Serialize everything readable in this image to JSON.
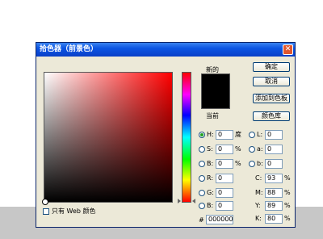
{
  "window": {
    "title": "拾色器（前景色）",
    "close": "✕"
  },
  "preview": {
    "new_label": "新的",
    "current_label": "当前"
  },
  "buttons": {
    "ok": "确定",
    "cancel": "取消",
    "add_swatch": "添加到色板",
    "color_library": "颜色库"
  },
  "hsb": {
    "h": {
      "label": "H:",
      "value": "0",
      "unit": "度",
      "selected": true
    },
    "s": {
      "label": "S:",
      "value": "0",
      "unit": "%"
    },
    "b": {
      "label": "B:",
      "value": "0",
      "unit": "%"
    }
  },
  "lab": {
    "l": {
      "label": "L:",
      "value": "0"
    },
    "a": {
      "label": "a:",
      "value": "0"
    },
    "b": {
      "label": "b:",
      "value": "0"
    }
  },
  "rgb": {
    "r": {
      "label": "R:",
      "value": "0"
    },
    "g": {
      "label": "G:",
      "value": "0"
    },
    "b": {
      "label": "B:",
      "value": "0"
    }
  },
  "cmyk": {
    "c": {
      "label": "C:",
      "value": "93",
      "unit": "%"
    },
    "m": {
      "label": "M:",
      "value": "88",
      "unit": "%"
    },
    "y": {
      "label": "Y:",
      "value": "89",
      "unit": "%"
    },
    "k": {
      "label": "K:",
      "value": "80",
      "unit": "%"
    }
  },
  "hex": {
    "label": "#",
    "value": "000000"
  },
  "web_only": {
    "label": "只有 Web 颜色",
    "checked": false
  },
  "colors": {
    "current": "#000000",
    "hue": "#ff0000"
  }
}
